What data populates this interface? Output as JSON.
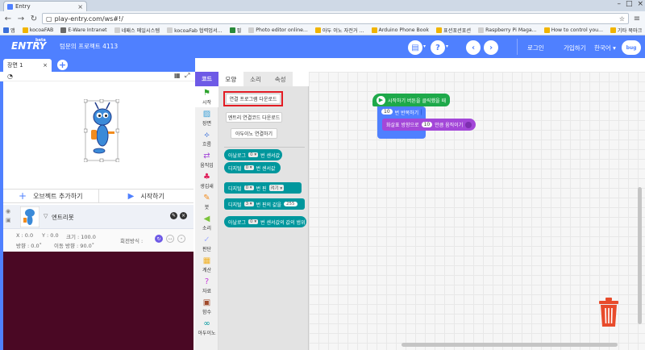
{
  "browser": {
    "tab_title": "Entry",
    "url": "play-entry.com/ws#!/",
    "bookmarks": [
      {
        "label": "앱",
        "color": "#3b6fd8"
      },
      {
        "label": "kocoaFAB",
        "color": "#f1b400"
      },
      {
        "label": "E-Ware Intranet",
        "color": "#6a6a6a"
      },
      {
        "label": "네패스 메일시스템",
        "color": "#cfcfcf"
      },
      {
        "label": "kocoaFab 협력업서...",
        "color": "#cfcfcf"
      },
      {
        "label": "필",
        "color": "#2a8a3a"
      },
      {
        "label": "Photo editor online...",
        "color": "#cfcfcf"
      },
      {
        "label": "아두 이노 자전거 ...",
        "color": "#f1b400"
      },
      {
        "label": "Arduino Phone Book",
        "color": "#f1b400"
      },
      {
        "label": "표션포션포션",
        "color": "#f1b400"
      },
      {
        "label": "Raspberry Pi Maga...",
        "color": "#cfcfcf"
      },
      {
        "label": "How to control you...",
        "color": "#f1b400"
      },
      {
        "label": "기타 북마크",
        "color": "#f1b400"
      }
    ]
  },
  "header": {
    "logo": "ENTRY",
    "logo_badge": "beta",
    "project_title": "텀문의 프로젝트 4113",
    "login": "로그인",
    "signup": "가입하기",
    "language": "한국어 ▾",
    "bug": "bug"
  },
  "scene": {
    "tab_label": "장면 1",
    "close": "×",
    "add": "+"
  },
  "stage": {
    "add_object": "오브젝트 추가하기",
    "start": "시작하기"
  },
  "object": {
    "name": "엔트리봇",
    "x_label": "X : 0.0",
    "y_label": "Y : 0.0",
    "size_label": "크기 : 100.0",
    "direction_label": "방향 : 0.0˚",
    "move_direction_label": "이동 방향 : 90.0˚",
    "rotation_label": "회전방식 :"
  },
  "categories": [
    {
      "label": "시작",
      "icon": "flag-icon",
      "color": "#2ea32e"
    },
    {
      "label": "장면",
      "icon": "scene-icon",
      "color": "#3aa0d8"
    },
    {
      "label": "흐름",
      "icon": "flow-icon",
      "color": "#3b6fd8"
    },
    {
      "label": "움직임",
      "icon": "move-icon",
      "color": "#a347d8"
    },
    {
      "label": "생김새",
      "icon": "looks-icon",
      "color": "#e0245e"
    },
    {
      "label": "붓",
      "icon": "brush-icon",
      "color": "#f28c1e"
    },
    {
      "label": "소리",
      "icon": "sound-icon",
      "color": "#7cc33a"
    },
    {
      "label": "판단",
      "icon": "judge-icon",
      "color": "#a3b0ff"
    },
    {
      "label": "계산",
      "icon": "calc-icon",
      "color": "#f2b020"
    },
    {
      "label": "자료",
      "icon": "data-icon",
      "color": "#c63ad8"
    },
    {
      "label": "함수",
      "icon": "function-icon",
      "color": "#a14a2a"
    },
    {
      "label": "아두이노",
      "icon": "arduino-icon",
      "color": "#00979d"
    }
  ],
  "block_tabs": {
    "top": "코드",
    "tabs": [
      "모양",
      "소리",
      "속성"
    ]
  },
  "block_menu": {
    "buttons": [
      "연결 프로그램 다운로드",
      "엔트리 연결코드 다운로드",
      "아두이노 연결하기"
    ],
    "blocks": [
      {
        "pre": "아날로그",
        "slot": "0 ▾",
        "post": "번 센서값"
      },
      {
        "pre": "디지털",
        "slot": "0 ▾",
        "post": "번 센서값"
      },
      {
        "pre": "디지털",
        "slot": "0 ▾",
        "post": "번 핀",
        "oval": "켜기 ▾"
      },
      {
        "pre": "디지털",
        "slot": "3 ▾",
        "post": "번 핀의 값을",
        "oval": "255"
      },
      {
        "pre": "아날로그",
        "slot": "0 ▾",
        "post": "번 센서값의 값의 범위"
      }
    ]
  },
  "workspace": {
    "start_block": "시작하기 버튼을 클릭했을 때",
    "repeat_count": "10",
    "repeat_label": "번 반복하기",
    "move_label": "화살표 방향으로",
    "move_count": "10",
    "move_suffix": "만큼 움직이기",
    "colors": {
      "start": "#1ea94a",
      "loop": "#4f80ff",
      "move": "#a347d8"
    }
  }
}
